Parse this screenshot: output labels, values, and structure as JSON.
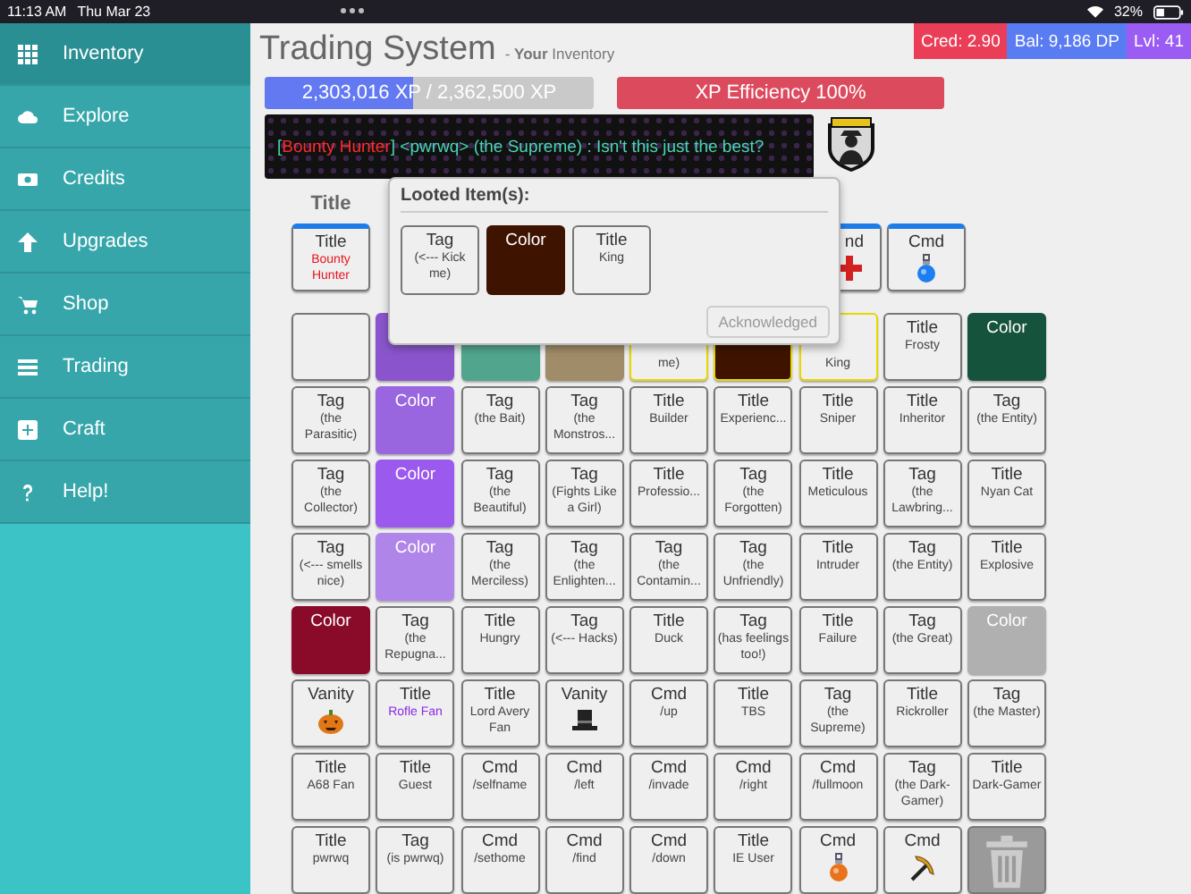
{
  "status_bar": {
    "time": "11:13 AM",
    "date": "Thu Mar 23",
    "battery": "32%"
  },
  "sidebar": {
    "items": [
      {
        "label": "Inventory",
        "selected": true
      },
      {
        "label": "Explore",
        "selected": false
      },
      {
        "label": "Credits",
        "selected": false
      },
      {
        "label": "Upgrades",
        "selected": false
      },
      {
        "label": "Shop",
        "selected": false
      },
      {
        "label": "Trading",
        "selected": false
      },
      {
        "label": "Craft",
        "selected": false
      },
      {
        "label": "Help!",
        "selected": false
      }
    ]
  },
  "header": {
    "title": "Trading System",
    "subtitle": "- **Your** Inventory"
  },
  "badges": [
    {
      "text": "Cred: 2.90",
      "color": "#ea3e58"
    },
    {
      "text": "Bal: 9,186 DP",
      "color": "#5a7cf2"
    },
    {
      "text": "Lvl: 41",
      "color": "#9a5cf2"
    }
  ],
  "xp_bar": {
    "text": "2,303,016 XP / 2,362,500 XP",
    "level": 0.45
  },
  "efficiency_bar": {
    "text": "XP Efficiency 100%"
  },
  "banner": {
    "segments": [
      {
        "text": "[",
        "color": "#46d6b4"
      },
      {
        "text": "Bounty Hunter",
        "color": "#ff2a2a"
      },
      {
        "text": "] <pwrwq> (the Supreme) : Isn't this just the best?",
        "color": "#46d6b4"
      }
    ]
  },
  "equipped": {
    "heading": "Title",
    "items": [
      {
        "kind": "text",
        "label": "Title",
        "sub": "Bounty Hunter",
        "color": "#e8141e"
      },
      {
        "kind": "partial",
        "label": "nd"
      },
      {
        "kind": "potion",
        "label": "Cmd",
        "color": "#1c7ef0"
      }
    ]
  },
  "inventory": {
    "rows": [
      [
        {
          "kind": "empty",
          "highlighted": false
        },
        {
          "kind": "color",
          "color": "#8a55cc",
          "highlighted": false
        },
        {
          "kind": "color",
          "color": "#52a58d",
          "highlighted": false
        },
        {
          "kind": "color",
          "color": "#a08c68",
          "highlighted": false
        },
        {
          "kind": "covered",
          "sub": "me)",
          "highlighted": true
        },
        {
          "kind": "color",
          "color": "#3e1400",
          "highlighted": true
        },
        {
          "kind": "covered",
          "sub": "King",
          "highlighted": true
        },
        {
          "kind": "text",
          "label": "Title",
          "sub": "Frosty",
          "highlighted": false
        },
        {
          "kind": "color",
          "label": "Color",
          "color": "#15533c",
          "highlighted": false
        }
      ],
      [
        {
          "kind": "text",
          "label": "Tag",
          "sub": "(the Parasitic)",
          "highlighted": false
        },
        {
          "kind": "color",
          "label": "Color",
          "color": "#9a66e0",
          "highlighted": false
        },
        {
          "kind": "text",
          "label": "Tag",
          "sub": "(the Bait)",
          "highlighted": false
        },
        {
          "kind": "text",
          "label": "Tag",
          "sub": "(the Monstros...",
          "highlighted": false
        },
        {
          "kind": "text",
          "label": "Title",
          "sub": "Builder",
          "highlighted": false
        },
        {
          "kind": "text",
          "label": "Title",
          "sub": "Experienc...",
          "highlighted": false
        },
        {
          "kind": "text",
          "label": "Title",
          "sub": "Sniper",
          "highlighted": false
        },
        {
          "kind": "text",
          "label": "Title",
          "sub": "Inheritor",
          "highlighted": false
        },
        {
          "kind": "text",
          "label": "Tag",
          "sub": "(the Entity)",
          "highlighted": false
        }
      ],
      [
        {
          "kind": "text",
          "label": "Tag",
          "sub": "(the Collector)",
          "highlighted": false
        },
        {
          "kind": "color",
          "label": "Color",
          "color": "#9b59ee",
          "highlighted": false
        },
        {
          "kind": "text",
          "label": "Tag",
          "sub": "(the Beautiful)",
          "highlighted": false
        },
        {
          "kind": "text",
          "label": "Tag",
          "sub": "(Fights Like a Girl)",
          "highlighted": false
        },
        {
          "kind": "text",
          "label": "Title",
          "sub": "Professio...",
          "highlighted": false
        },
        {
          "kind": "text",
          "label": "Tag",
          "sub": "(the Forgotten)",
          "highlighted": false
        },
        {
          "kind": "text",
          "label": "Title",
          "sub": "Meticulous",
          "highlighted": false
        },
        {
          "kind": "text",
          "label": "Tag",
          "sub": "(the Lawbring...",
          "highlighted": false
        },
        {
          "kind": "text",
          "label": "Title",
          "sub": "Nyan Cat",
          "highlighted": false
        }
      ],
      [
        {
          "kind": "text",
          "label": "Tag",
          "sub": "(<--- smells nice)",
          "highlighted": false
        },
        {
          "kind": "color",
          "label": "Color",
          "color": "#b085ea",
          "highlighted": false
        },
        {
          "kind": "text",
          "label": "Tag",
          "sub": "(the Merciless)",
          "highlighted": false
        },
        {
          "kind": "text",
          "label": "Tag",
          "sub": "(the Enlighten...",
          "highlighted": false
        },
        {
          "kind": "text",
          "label": "Tag",
          "sub": "(the Contamin...",
          "highlighted": false
        },
        {
          "kind": "text",
          "label": "Tag",
          "sub": "(the Unfriendly)",
          "highlighted": false
        },
        {
          "kind": "text",
          "label": "Title",
          "sub": "Intruder",
          "highlighted": false
        },
        {
          "kind": "text",
          "label": "Tag",
          "sub": "(the Entity)",
          "highlighted": false
        },
        {
          "kind": "text",
          "label": "Title",
          "sub": "Explosive",
          "highlighted": false
        }
      ],
      [
        {
          "kind": "color",
          "label": "Color",
          "color": "#8a0a2a",
          "highlighted": false
        },
        {
          "kind": "text",
          "label": "Tag",
          "sub": "(the Repugna...",
          "highlighted": false
        },
        {
          "kind": "text",
          "label": "Title",
          "sub": "Hungry",
          "highlighted": false
        },
        {
          "kind": "text",
          "label": "Tag",
          "sub": "(<--- Hacks)",
          "highlighted": false
        },
        {
          "kind": "text",
          "label": "Title",
          "sub": "Duck",
          "highlighted": false
        },
        {
          "kind": "text",
          "label": "Tag",
          "sub": "(has feelings too!)",
          "highlighted": false
        },
        {
          "kind": "text",
          "label": "Title",
          "sub": "Failure",
          "highlighted": false
        },
        {
          "kind": "text",
          "label": "Tag",
          "sub": "(the Great)",
          "highlighted": false
        },
        {
          "kind": "color",
          "label": "Color",
          "color": "#b0b0b0",
          "highlighted": false
        }
      ],
      [
        {
          "kind": "pumpkin",
          "label": "Vanity",
          "highlighted": false
        },
        {
          "kind": "text",
          "label": "Title",
          "sub": "Rofle Fan",
          "color": "#8a2be2",
          "highlighted": false
        },
        {
          "kind": "text",
          "label": "Title",
          "sub": "Lord Avery Fan",
          "highlighted": false
        },
        {
          "kind": "hat",
          "label": "Vanity",
          "highlighted": false
        },
        {
          "kind": "text",
          "label": "Cmd",
          "sub": "/up",
          "highlighted": false
        },
        {
          "kind": "text",
          "label": "Title",
          "sub": "TBS",
          "highlighted": false
        },
        {
          "kind": "text",
          "label": "Tag",
          "sub": "(the Supreme)",
          "highlighted": false
        },
        {
          "kind": "text",
          "label": "Title",
          "sub": "Rickroller",
          "highlighted": false
        },
        {
          "kind": "text",
          "label": "Tag",
          "sub": "(the Master)",
          "highlighted": false
        }
      ],
      [
        {
          "kind": "text",
          "label": "Title",
          "sub": "A68 Fan",
          "highlighted": false
        },
        {
          "kind": "text",
          "label": "Title",
          "sub": "Guest",
          "highlighted": false
        },
        {
          "kind": "text",
          "label": "Cmd",
          "sub": "/selfname",
          "highlighted": false
        },
        {
          "kind": "text",
          "label": "Cmd",
          "sub": "/left",
          "highlighted": false
        },
        {
          "kind": "text",
          "label": "Cmd",
          "sub": "/invade",
          "highlighted": false
        },
        {
          "kind": "text",
          "label": "Cmd",
          "sub": "/right",
          "highlighted": false
        },
        {
          "kind": "text",
          "label": "Cmd",
          "sub": "/fullmoon",
          "highlighted": false
        },
        {
          "kind": "text",
          "label": "Tag",
          "sub": "(the Dark-Gamer)",
          "highlighted": false
        },
        {
          "kind": "text",
          "label": "Title",
          "sub": "Dark-Gamer",
          "highlighted": false
        }
      ],
      [
        {
          "kind": "text",
          "label": "Title",
          "sub": "pwrwq",
          "highlighted": false
        },
        {
          "kind": "text",
          "label": "Tag",
          "sub": "(is pwrwq)",
          "highlighted": false
        },
        {
          "kind": "text",
          "label": "Cmd",
          "sub": "/sethome",
          "highlighted": false
        },
        {
          "kind": "text",
          "label": "Cmd",
          "sub": "/find",
          "highlighted": false
        },
        {
          "kind": "text",
          "label": "Cmd",
          "sub": "/down",
          "highlighted": false
        },
        {
          "kind": "text",
          "label": "Title",
          "sub": "IE User",
          "highlighted": false
        },
        {
          "kind": "potion",
          "label": "Cmd",
          "color": "#e8731c",
          "highlighted": false
        },
        {
          "kind": "pickaxe",
          "label": "Cmd",
          "highlighted": false
        },
        {
          "kind": "trash",
          "highlighted": false
        }
      ]
    ]
  },
  "modal": {
    "title": "Looted Item(s):",
    "items": [
      {
        "kind": "text",
        "label": "Tag",
        "sub": "(<--- Kick me)"
      },
      {
        "kind": "color",
        "label": "Color",
        "color": "#3e1400"
      },
      {
        "kind": "text",
        "label": "Title",
        "sub": "King"
      }
    ],
    "button": {
      "label": "Acknowledged",
      "disabled": true
    }
  }
}
